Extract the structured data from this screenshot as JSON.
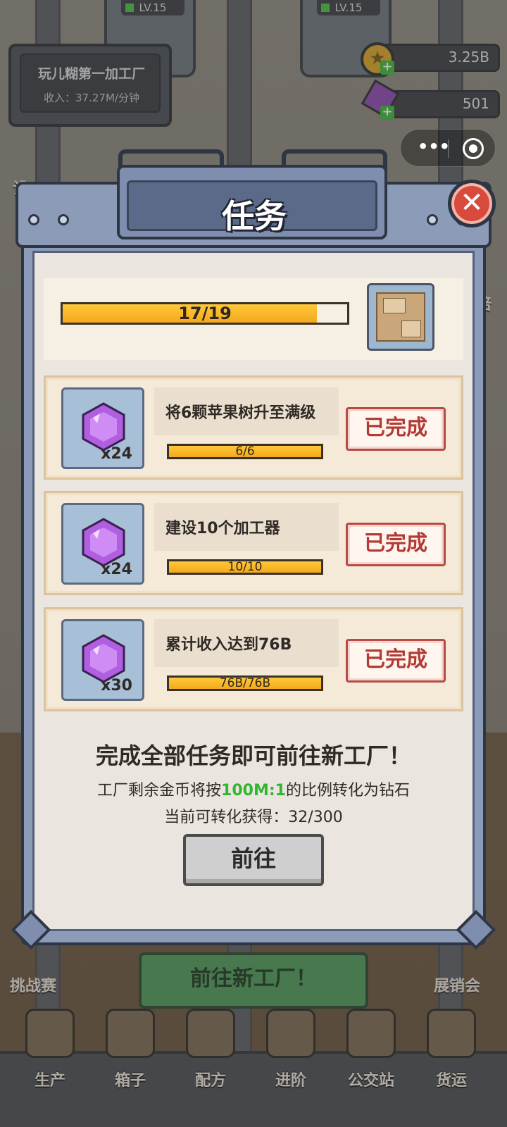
{
  "header": {
    "factory_name": "玩儿糊第一加工厂",
    "factory_income": "收入：37.27M/分钟",
    "machine_levels": [
      "LV.15",
      "LV.15"
    ]
  },
  "resources": {
    "coins": "3.25B",
    "gems": "501"
  },
  "dialog": {
    "title": "任务",
    "progress": {
      "text": "17/19",
      "current": 17,
      "total": 19
    },
    "tasks": [
      {
        "reward_qty": "x24",
        "description": "将6颗苹果树升至满级",
        "progress_text": "6/6",
        "progress": 1.0,
        "status": "已完成"
      },
      {
        "reward_qty": "x24",
        "description": "建设10个加工器",
        "progress_text": "10/10",
        "progress": 1.0,
        "status": "已完成"
      },
      {
        "reward_qty": "x30",
        "description": "累计收入达到76B",
        "progress_text": "76B/76B",
        "progress": 1.0,
        "status": "已完成"
      }
    ],
    "footer": {
      "title": "完成全部任务即可前往新工厂！",
      "line1_prefix": "工厂剩余金币将按",
      "line1_highlight": "100M:1",
      "line1_suffix": "的比例转化为钻石",
      "line2": "当前可转化获得：32/300",
      "go_button": "前往"
    }
  },
  "background": {
    "left_labels": [
      "设",
      "挑战赛"
    ],
    "right_labels": [
      "倍",
      "展销会"
    ],
    "new_factory_button": "前往新工厂！"
  },
  "bottom_nav": [
    {
      "label": "生产",
      "icon": "robot-arm-icon"
    },
    {
      "label": "箱子",
      "icon": "crate-icon"
    },
    {
      "label": "配方",
      "icon": "recipe-book-icon"
    },
    {
      "label": "进阶",
      "icon": "upgrade-icon"
    },
    {
      "label": "公交站",
      "icon": "bus-stop-icon"
    },
    {
      "label": "货运",
      "icon": "cargo-icon"
    }
  ],
  "colors": {
    "progress_fill": "#f4a91c",
    "done_red": "#b33b36",
    "highlight_green": "#2fb82f",
    "dialog_frame": "#8c9bb8",
    "close_red": "#d84a3c"
  }
}
